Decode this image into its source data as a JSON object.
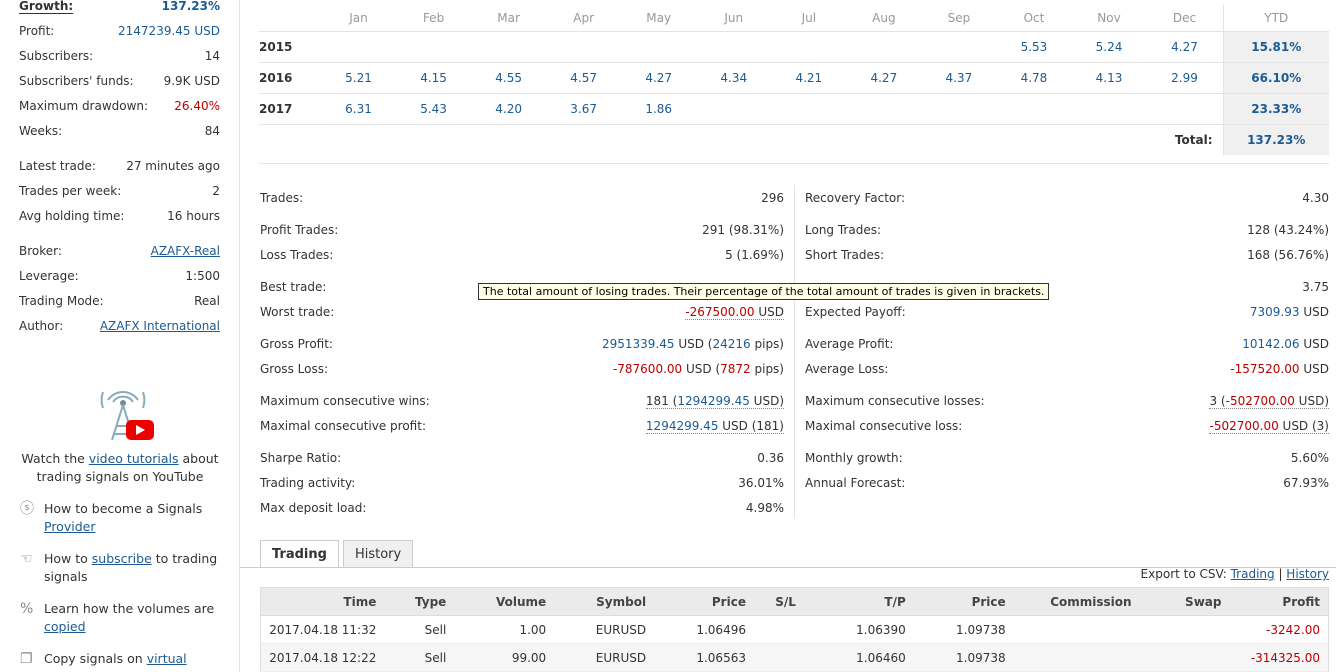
{
  "sidebar": {
    "stats": [
      {
        "label": "Growth:",
        "value": "137.23%"
      },
      {
        "label": "Profit:",
        "value": "2147239.45 USD"
      },
      {
        "label": "Subscribers:",
        "value": "14"
      },
      {
        "label": "Subscribers' funds:",
        "value": "9.9K USD"
      },
      {
        "label": "Maximum drawdown:",
        "value": "26.40%"
      },
      {
        "label": "Weeks:",
        "value": "84"
      },
      {
        "label": "Latest trade:",
        "value": "27 minutes ago"
      },
      {
        "label": "Trades per week:",
        "value": "2"
      },
      {
        "label": "Avg holding time:",
        "value": "16 hours"
      },
      {
        "label": "Broker:",
        "value": "AZAFX-Real"
      },
      {
        "label": "Leverage:",
        "value": "1:500"
      },
      {
        "label": "Trading Mode:",
        "value": "Real"
      },
      {
        "label": "Author:",
        "value": "AZAFX International"
      }
    ],
    "youtube": {
      "pre": "Watch the ",
      "link": "video tutorials",
      "post": " about trading signals on YouTube"
    },
    "help": [
      {
        "pre": "How to become a Signals ",
        "link": "Provider",
        "post": "",
        "icon": "dollar-icon"
      },
      {
        "pre": "How to ",
        "link": "subscribe",
        "post": " to trading signals",
        "icon": "hand-icon"
      },
      {
        "pre": "Learn how the volumes are ",
        "link": "copied",
        "post": "",
        "icon": "percent-icon"
      },
      {
        "pre": "Copy signals on ",
        "link": "virtual",
        "post": "",
        "icon": "copy-icon"
      }
    ]
  },
  "monthly": {
    "headers": [
      "Jan",
      "Feb",
      "Mar",
      "Apr",
      "May",
      "Jun",
      "Jul",
      "Aug",
      "Sep",
      "Oct",
      "Nov",
      "Dec",
      "YTD"
    ],
    "rows": [
      {
        "year": "2015",
        "values": [
          "",
          "",
          "",
          "",
          "",
          "",
          "",
          "",
          "",
          "5.53",
          "5.24",
          "4.27"
        ],
        "ytd": "15.81%"
      },
      {
        "year": "2016",
        "values": [
          "5.21",
          "4.15",
          "4.55",
          "4.57",
          "4.27",
          "4.34",
          "4.21",
          "4.27",
          "4.37",
          "4.78",
          "4.13",
          "2.99"
        ],
        "ytd": "66.10%"
      },
      {
        "year": "2017",
        "values": [
          "6.31",
          "5.43",
          "4.20",
          "3.67",
          "1.86",
          "",
          "",
          "",
          "",
          "",
          "",
          ""
        ],
        "ytd": "23.33%"
      }
    ],
    "total_label": "Total:",
    "total_value": "137.23%"
  },
  "stats_left": {
    "trades": {
      "label": "Trades:",
      "value": "296"
    },
    "profit_trades": {
      "label": "Profit Trades:",
      "value": "291 (98.31%)"
    },
    "loss_trades": {
      "label": "Loss Trades:",
      "value": "5 (1.69%)"
    },
    "best_trade": {
      "label": "Best trade:"
    },
    "worst_trade": {
      "label": "Worst trade:",
      "value": "-267500.00",
      "unit": " USD"
    },
    "gross_profit": {
      "label": "Gross Profit:",
      "value": "2951339.45",
      "mid": " USD (",
      "pips": "24216",
      "end": " pips)"
    },
    "gross_loss": {
      "label": "Gross Loss:",
      "value": "-787600.00",
      "mid": " USD (",
      "pips": "7872",
      "end": " pips)"
    },
    "max_cons_wins": {
      "label": "Maximum consecutive wins:",
      "pre": "181 (",
      "value": "1294299.45",
      "end": " USD)"
    },
    "max_cons_profit": {
      "label": "Maximal consecutive profit:",
      "value": "1294299.45",
      "end": " USD (181)"
    },
    "sharpe": {
      "label": "Sharpe Ratio:",
      "value": "0.36"
    },
    "activity": {
      "label": "Trading activity:",
      "value": "36.01%"
    },
    "deposit_load": {
      "label": "Max deposit load:",
      "value": "4.98%"
    }
  },
  "stats_right": {
    "recovery": {
      "label": "Recovery Factor:",
      "value": "4.30"
    },
    "long": {
      "label": "Long Trades:",
      "value": "128 (43.24%)"
    },
    "short": {
      "label": "Short Trades:",
      "value": "168 (56.76%)"
    },
    "profit_factor": {
      "value": "3.75"
    },
    "expected": {
      "label": "Expected Payoff:",
      "value": "7309.93",
      "unit": " USD"
    },
    "avg_profit": {
      "label": "Average Profit:",
      "value": "10142.06",
      "unit": " USD"
    },
    "avg_loss": {
      "label": "Average Loss:",
      "value": "-157520.00",
      "unit": " USD"
    },
    "max_cons_losses": {
      "label": "Maximum consecutive losses:",
      "pre": "3 (",
      "value": "-502700.00",
      "end": " USD)"
    },
    "max_cons_loss": {
      "label": "Maximal consecutive loss:",
      "value": "-502700.00",
      "end": " USD (3)"
    },
    "monthly_growth": {
      "label": "Monthly growth:",
      "value": "5.60%"
    },
    "annual": {
      "label": "Annual Forecast:",
      "value": "67.93%"
    }
  },
  "tooltip": "The total amount of losing trades. Their percentage of the total amount of trades is given in brackets.",
  "tabs": {
    "trading": "Trading",
    "history": "History"
  },
  "export": {
    "label": "Export to CSV: ",
    "trading": "Trading",
    "sep": " | ",
    "history": "History"
  },
  "trades": {
    "headers": [
      "Time",
      "Type",
      "Volume",
      "Symbol",
      "Price",
      "S/L",
      "T/P",
      "Price",
      "Commission",
      "Swap",
      "Profit"
    ],
    "rows": [
      [
        "2017.04.18 11:32",
        "Sell",
        "1.00",
        "EURUSD",
        "1.06496",
        "",
        "1.06390",
        "1.09738",
        "",
        "",
        "-3242.00"
      ],
      [
        "2017.04.18 12:22",
        "Sell",
        "99.00",
        "EURUSD",
        "1.06563",
        "",
        "1.06460",
        "1.09738",
        "",
        "",
        "-314325.00"
      ]
    ]
  },
  "colors": {
    "link": "#1c5b93",
    "negative": "#bb0000",
    "tooltip_bg": "#ffffe6"
  }
}
